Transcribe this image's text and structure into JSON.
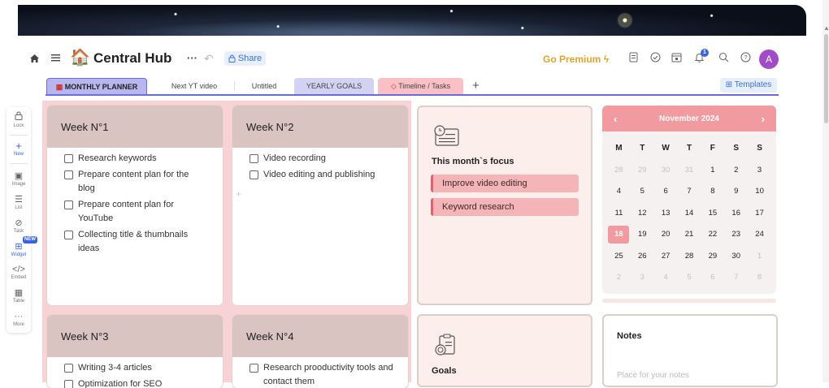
{
  "header": {
    "title": "Central Hub",
    "page_emoji": "🏠",
    "share_label": "Share",
    "premium_label": "Go Premium",
    "notification_count": "1",
    "avatar_initial": "A",
    "more_label": "···"
  },
  "tabs": [
    {
      "label": "MONTHLY PLANNER"
    },
    {
      "label": "Next YT video"
    },
    {
      "label": "Untitled"
    },
    {
      "label": "YEARLY GOALS"
    },
    {
      "label": "Timeline / Tasks"
    }
  ],
  "templates_label": "Templates",
  "left_toolbar": [
    {
      "label": "Lock",
      "icon": "lock-icon"
    },
    {
      "label": "New",
      "icon": "plus-icon"
    },
    {
      "label": "Image",
      "icon": "image-icon"
    },
    {
      "label": "List",
      "icon": "list-icon"
    },
    {
      "label": "Task",
      "icon": "task-icon"
    },
    {
      "label": "Widget",
      "icon": "widget-icon"
    },
    {
      "label": "Embed",
      "icon": "embed-icon"
    },
    {
      "label": "Table",
      "icon": "table-icon"
    },
    {
      "label": "More",
      "icon": "more-icon"
    }
  ],
  "new_badge": "NEW",
  "weeks": [
    {
      "title": "Week N°1",
      "tasks": [
        "Research keywords",
        "Prepare content plan for the blog",
        "Prepare content plan for YouTube",
        "Collecting title & thumbnails ideas"
      ]
    },
    {
      "title": "Week N°2",
      "tasks": [
        "Video recording",
        "Video editing and publishing"
      ]
    },
    {
      "title": "Week N°3",
      "tasks": [
        "Writing 3-4 articles",
        "Optimization for SEO"
      ]
    },
    {
      "title": "Week N°4",
      "tasks": [
        "Research prooductivity tools and contact them"
      ]
    }
  ],
  "focus": {
    "title": "This month`s focus",
    "items": [
      "Improve video editing",
      "Keyword research"
    ]
  },
  "goals": {
    "title": "Goals"
  },
  "notes": {
    "title": "Notes",
    "placeholder": "Place for your notes"
  },
  "calendar": {
    "month_label": "November 2024",
    "prev": "‹",
    "next": "›",
    "weekdays": [
      "M",
      "T",
      "W",
      "T",
      "F",
      "S",
      "S"
    ],
    "today": "18",
    "days": [
      {
        "d": "28",
        "m": true
      },
      {
        "d": "29",
        "m": true
      },
      {
        "d": "30",
        "m": true
      },
      {
        "d": "31",
        "m": true
      },
      {
        "d": "1"
      },
      {
        "d": "2"
      },
      {
        "d": "3"
      },
      {
        "d": "4"
      },
      {
        "d": "5"
      },
      {
        "d": "6"
      },
      {
        "d": "7"
      },
      {
        "d": "8"
      },
      {
        "d": "9"
      },
      {
        "d": "10"
      },
      {
        "d": "11"
      },
      {
        "d": "12"
      },
      {
        "d": "13"
      },
      {
        "d": "14"
      },
      {
        "d": "15"
      },
      {
        "d": "16"
      },
      {
        "d": "17"
      },
      {
        "d": "18"
      },
      {
        "d": "19"
      },
      {
        "d": "20"
      },
      {
        "d": "21"
      },
      {
        "d": "22"
      },
      {
        "d": "23"
      },
      {
        "d": "24"
      },
      {
        "d": "25"
      },
      {
        "d": "26"
      },
      {
        "d": "27"
      },
      {
        "d": "28"
      },
      {
        "d": "29"
      },
      {
        "d": "30"
      },
      {
        "d": "1",
        "m": true
      },
      {
        "d": "2",
        "m": true
      },
      {
        "d": "3",
        "m": true
      },
      {
        "d": "4",
        "m": true
      },
      {
        "d": "5",
        "m": true
      },
      {
        "d": "6",
        "m": true
      },
      {
        "d": "7",
        "m": true
      },
      {
        "d": "8",
        "m": true
      }
    ]
  },
  "colors": {
    "accent": "#6a6ad8",
    "calendar_header": "#f19a9f",
    "planner_bg": "#f8d3d6",
    "week_header": "#d9c4c1",
    "premium": "#e0a52a"
  }
}
